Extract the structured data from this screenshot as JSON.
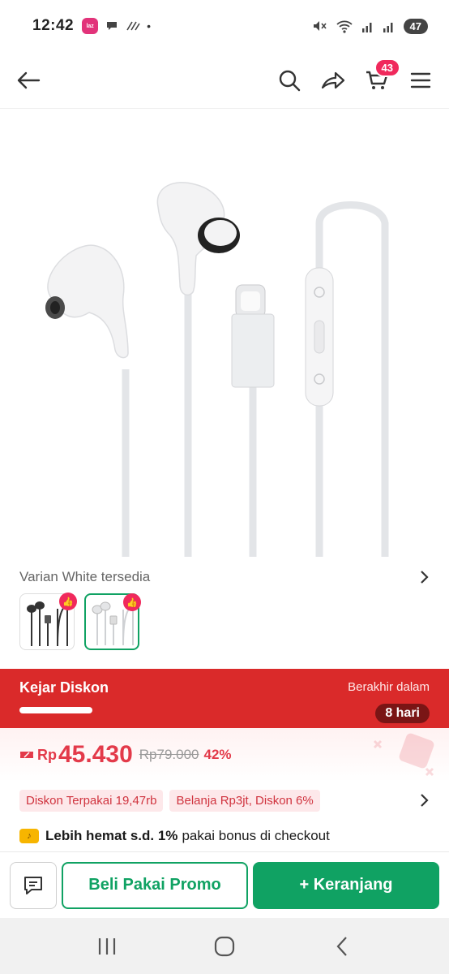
{
  "status_bar": {
    "time": "12:42",
    "app_icon_label": "laz",
    "signal_label": "5",
    "battery": "47"
  },
  "top_nav": {
    "cart_count": "43",
    "icons": [
      "back-arrow-icon",
      "search-icon",
      "share-icon",
      "cart-icon",
      "menu-icon"
    ]
  },
  "product": {
    "image_description_icon": "earphones-image"
  },
  "variants": {
    "text": "Varian White tersedia",
    "options": [
      {
        "name": "Black",
        "selected": false
      },
      {
        "name": "White",
        "selected": true
      }
    ]
  },
  "deal": {
    "title": "Kejar Diskon",
    "ends_label": "Berakhir dalam",
    "days_left": "8 hari"
  },
  "price": {
    "currency": "Rp",
    "current": "45.430",
    "original": "Rp79.000",
    "discount": "42%"
  },
  "promos": [
    "Diskon Terpakai 19,47rb",
    "Belanja Rp3jt, Diskon 6%"
  ],
  "bonus": {
    "strong": "Lebih hemat s.d. 1%",
    "rest": "pakai bonus di checkout"
  },
  "actions": {
    "promo_button": "Beli Pakai Promo",
    "cart_button": "+ Keranjang"
  },
  "colors": {
    "brand_green": "#10a263",
    "deal_red": "#da2a2a",
    "price_red": "#e33a4a",
    "badge_pink": "#f0295c"
  }
}
